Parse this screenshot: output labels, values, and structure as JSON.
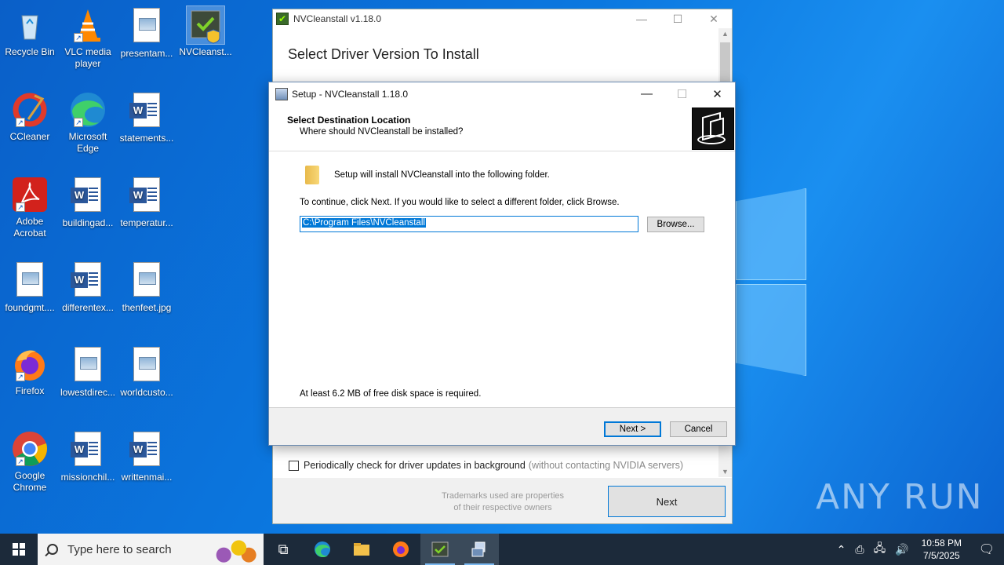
{
  "desktop": {
    "icons": [
      {
        "label": "Recycle Bin"
      },
      {
        "label": "VLC media player"
      },
      {
        "label": "presentam..."
      },
      {
        "label": "NVCleanst..."
      },
      {
        "label": "CCleaner"
      },
      {
        "label": "Microsoft Edge"
      },
      {
        "label": "statements..."
      },
      {
        "label": "Adobe Acrobat"
      },
      {
        "label": "buildingad..."
      },
      {
        "label": "temperatur..."
      },
      {
        "label": "foundgmt...."
      },
      {
        "label": "differentex..."
      },
      {
        "label": "thenfeet.jpg"
      },
      {
        "label": "Firefox"
      },
      {
        "label": "lowestdirec..."
      },
      {
        "label": "worldcusto..."
      },
      {
        "label": "Google Chrome"
      },
      {
        "label": "missionchil..."
      },
      {
        "label": "writtenmai..."
      }
    ]
  },
  "nv_window": {
    "title": "NVCleanstall v1.18.0",
    "heading": "Select Driver Version To Install",
    "checkbox_label": "Periodically check for driver updates in background",
    "checkbox_note": "(without contacting NVIDIA servers)",
    "trademark_line1": "Trademarks used are properties",
    "trademark_line2": "of their respective owners",
    "next_label": "Next"
  },
  "setup": {
    "title": "Setup - NVCleanstall 1.18.0",
    "header_title": "Select Destination Location",
    "header_subtitle": "Where should NVCleanstall be installed?",
    "line1": "Setup will install NVCleanstall into the following folder.",
    "line2": "To continue, click Next. If you would like to select a different folder, click Browse.",
    "path_value": "C:\\Program Files\\NVCleanstall",
    "browse_label": "Browse...",
    "space_note": "At least 6.2 MB of free disk space is required.",
    "next_label": "Next >",
    "cancel_label": "Cancel"
  },
  "watermark": "ANY RUN",
  "taskbar": {
    "search_placeholder": "Type here to search",
    "time": "10:58 PM",
    "date": "7/5/2025"
  }
}
